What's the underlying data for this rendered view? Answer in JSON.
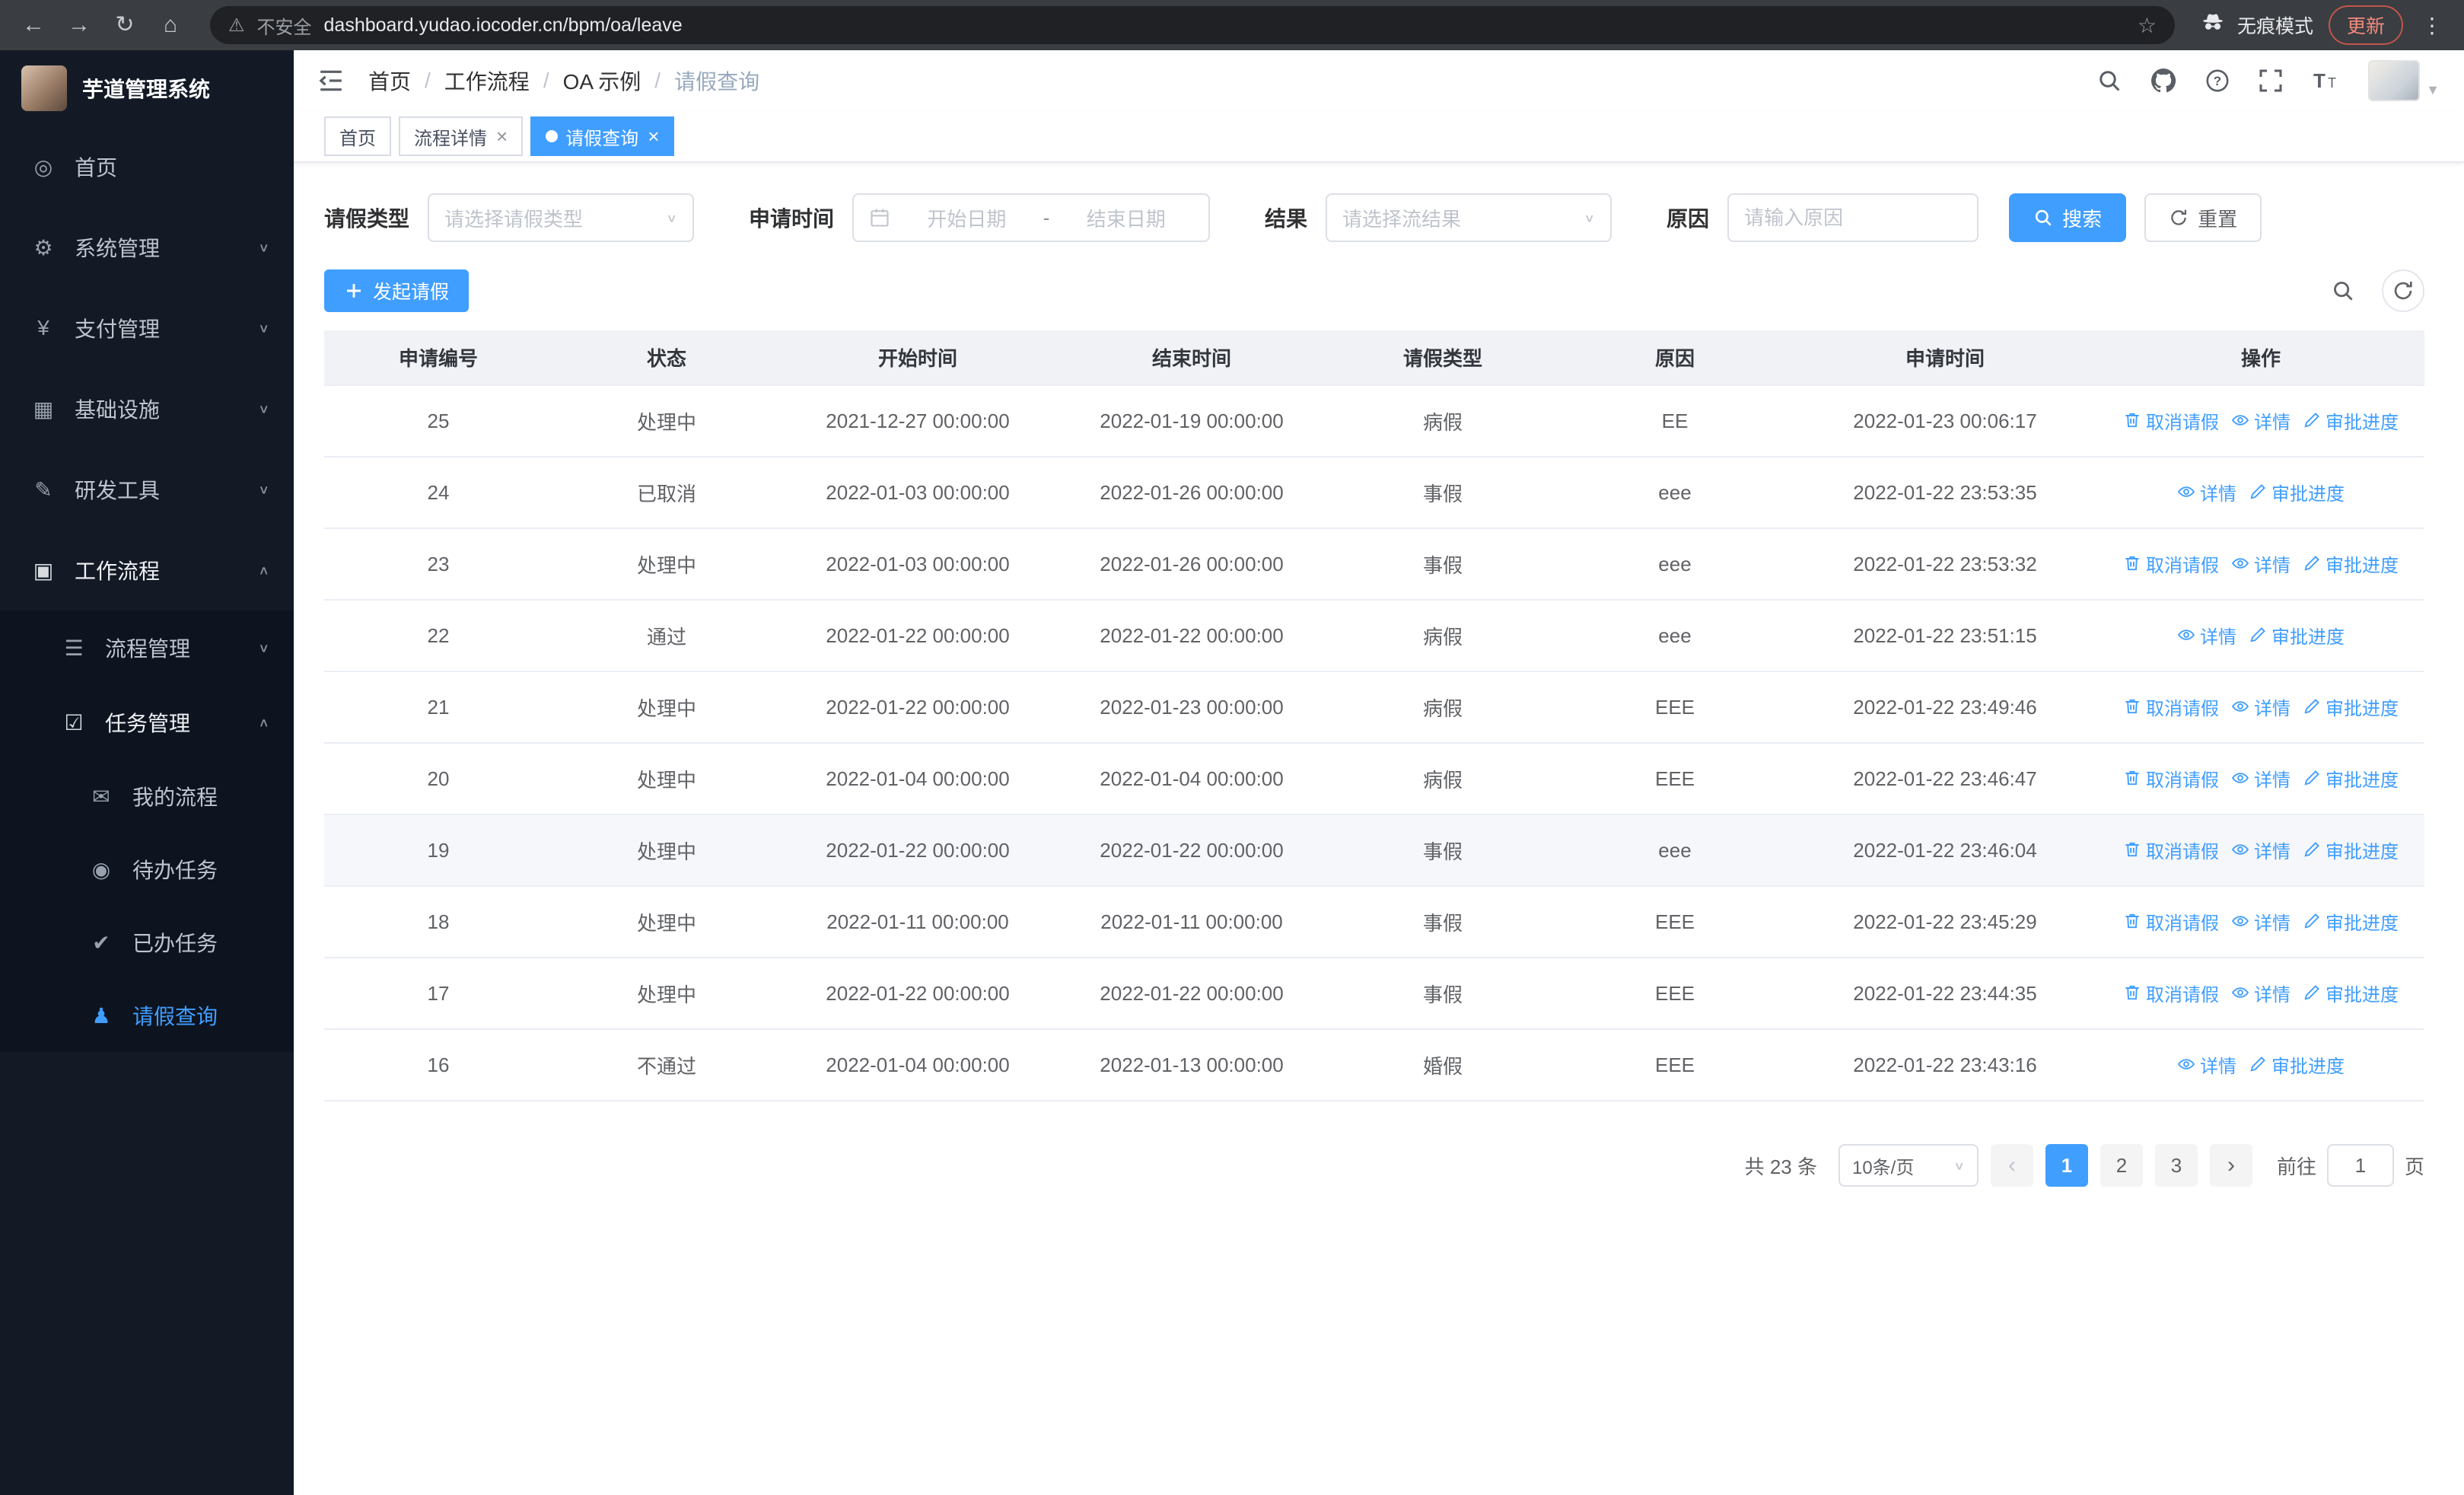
{
  "theme": {
    "primary": "#409EFF"
  },
  "browser": {
    "warning": "不安全",
    "url": "dashboard.yudao.iocoder.cn/bpm/oa/leave",
    "incognito_label": "无痕模式",
    "update_label": "更新"
  },
  "sidebar": {
    "title": "芋道管理系统",
    "menu": [
      {
        "key": "home",
        "label": "首页",
        "level": 1,
        "icon": "dashboard"
      },
      {
        "key": "system",
        "label": "系统管理",
        "level": 1,
        "icon": "gear",
        "chevron": "down"
      },
      {
        "key": "payment",
        "label": "支付管理",
        "level": 1,
        "icon": "yen",
        "chevron": "down"
      },
      {
        "key": "infra",
        "label": "基础设施",
        "level": 1,
        "icon": "infra",
        "chevron": "down"
      },
      {
        "key": "devtools",
        "label": "研发工具",
        "level": 1,
        "icon": "tools",
        "chevron": "down"
      },
      {
        "key": "workflow",
        "label": "工作流程",
        "level": 1,
        "icon": "briefcase",
        "chevron": "up",
        "open": true
      },
      {
        "key": "process-mgmt",
        "label": "流程管理",
        "level": 2,
        "icon": "list",
        "chevron": "down"
      },
      {
        "key": "task-mgmt",
        "label": "任务管理",
        "level": 2,
        "icon": "tasks",
        "chevron": "up",
        "open": true
      },
      {
        "key": "my-process",
        "label": "我的流程",
        "level": 3,
        "icon": "chat"
      },
      {
        "key": "todo-task",
        "label": "待办任务",
        "level": 3,
        "icon": "eye"
      },
      {
        "key": "done-task",
        "label": "已办任务",
        "level": 3,
        "icon": "check"
      },
      {
        "key": "leave-query",
        "label": "请假查询",
        "level": 3,
        "icon": "user",
        "active": true
      }
    ]
  },
  "navbar": {
    "breadcrumb": [
      "首页",
      "工作流程",
      "OA 示例",
      "请假查询"
    ]
  },
  "tabs": [
    {
      "key": "home",
      "label": "首页",
      "closable": false,
      "active": false
    },
    {
      "key": "process-detail",
      "label": "流程详情",
      "closable": true,
      "active": false
    },
    {
      "key": "leave-query",
      "label": "请假查询",
      "closable": true,
      "active": true
    }
  ],
  "filters": {
    "leave_type_label": "请假类型",
    "leave_type_placeholder": "请选择请假类型",
    "apply_time_label": "申请时间",
    "start_date_placeholder": "开始日期",
    "range_separator": "-",
    "end_date_placeholder": "结束日期",
    "result_label": "结果",
    "result_placeholder": "请选择流结果",
    "reason_label": "原因",
    "reason_placeholder": "请输入原因",
    "search_button": "搜索",
    "reset_button": "重置"
  },
  "toolbar": {
    "create_button": "发起请假"
  },
  "table": {
    "columns": [
      "申请编号",
      "状态",
      "开始时间",
      "结束时间",
      "请假类型",
      "原因",
      "申请时间",
      "操作"
    ],
    "action_labels": {
      "cancel": "取消请假",
      "detail": "详情",
      "progress": "审批进度"
    },
    "rows": [
      {
        "id": "25",
        "status": "处理中",
        "start": "2021-12-27 00:00:00",
        "end": "2022-01-19 00:00:00",
        "type": "病假",
        "reason": "EE",
        "applied": "2022-01-23 00:06:17",
        "actions": [
          "cancel",
          "detail",
          "progress"
        ]
      },
      {
        "id": "24",
        "status": "已取消",
        "start": "2022-01-03 00:00:00",
        "end": "2022-01-26 00:00:00",
        "type": "事假",
        "reason": "eee",
        "applied": "2022-01-22 23:53:35",
        "actions": [
          "detail",
          "progress"
        ]
      },
      {
        "id": "23",
        "status": "处理中",
        "start": "2022-01-03 00:00:00",
        "end": "2022-01-26 00:00:00",
        "type": "事假",
        "reason": "eee",
        "applied": "2022-01-22 23:53:32",
        "actions": [
          "cancel",
          "detail",
          "progress"
        ]
      },
      {
        "id": "22",
        "status": "通过",
        "start": "2022-01-22 00:00:00",
        "end": "2022-01-22 00:00:00",
        "type": "病假",
        "reason": "eee",
        "applied": "2022-01-22 23:51:15",
        "actions": [
          "detail",
          "progress"
        ]
      },
      {
        "id": "21",
        "status": "处理中",
        "start": "2022-01-22 00:00:00",
        "end": "2022-01-23 00:00:00",
        "type": "病假",
        "reason": "EEE",
        "applied": "2022-01-22 23:49:46",
        "actions": [
          "cancel",
          "detail",
          "progress"
        ]
      },
      {
        "id": "20",
        "status": "处理中",
        "start": "2022-01-04 00:00:00",
        "end": "2022-01-04 00:00:00",
        "type": "病假",
        "reason": "EEE",
        "applied": "2022-01-22 23:46:47",
        "actions": [
          "cancel",
          "detail",
          "progress"
        ]
      },
      {
        "id": "19",
        "status": "处理中",
        "start": "2022-01-22 00:00:00",
        "end": "2022-01-22 00:00:00",
        "type": "事假",
        "reason": "eee",
        "applied": "2022-01-22 23:46:04",
        "actions": [
          "cancel",
          "detail",
          "progress"
        ],
        "highlighted": true
      },
      {
        "id": "18",
        "status": "处理中",
        "start": "2022-01-11 00:00:00",
        "end": "2022-01-11 00:00:00",
        "type": "事假",
        "reason": "EEE",
        "applied": "2022-01-22 23:45:29",
        "actions": [
          "cancel",
          "detail",
          "progress"
        ]
      },
      {
        "id": "17",
        "status": "处理中",
        "start": "2022-01-22 00:00:00",
        "end": "2022-01-22 00:00:00",
        "type": "事假",
        "reason": "EEE",
        "applied": "2022-01-22 23:44:35",
        "actions": [
          "cancel",
          "detail",
          "progress"
        ]
      },
      {
        "id": "16",
        "status": "不通过",
        "start": "2022-01-04 00:00:00",
        "end": "2022-01-13 00:00:00",
        "type": "婚假",
        "reason": "EEE",
        "applied": "2022-01-22 23:43:16",
        "actions": [
          "detail",
          "progress"
        ]
      }
    ]
  },
  "pagination": {
    "total_label": "共 23 条",
    "page_size_label": "10条/页",
    "pages": [
      "1",
      "2",
      "3"
    ],
    "active_page": "1",
    "goto_label": "前往",
    "goto_value": "1",
    "page_unit": "页"
  }
}
